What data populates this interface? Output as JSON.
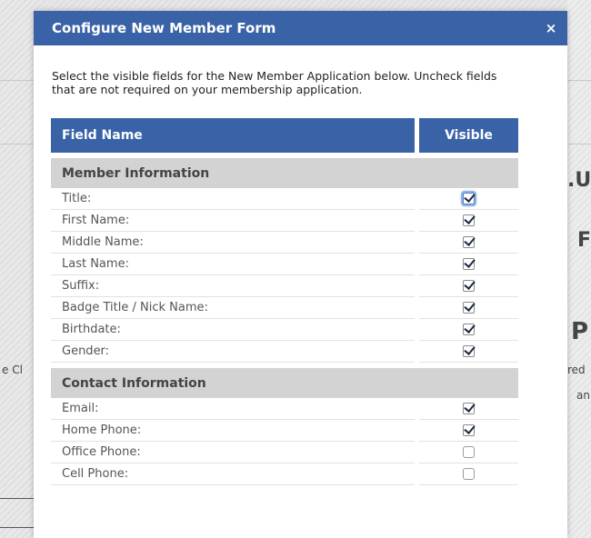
{
  "background": {
    "right_fragments": [
      ".U",
      "F",
      "P",
      "red",
      "an"
    ],
    "left_fragments": [
      "e Cl"
    ]
  },
  "modal": {
    "title": "Configure New Member Form",
    "close_icon": "close-icon",
    "close_glyph": "×",
    "intro": "Select the visible fields for the New Member Application below. Uncheck fields that are not required on your membership application.",
    "table": {
      "col_field": "Field Name",
      "col_visible": "Visible",
      "sections": [
        {
          "title": "Member Information",
          "fields": [
            {
              "label": "Title:",
              "visible": true,
              "focused": true
            },
            {
              "label": "First Name:",
              "visible": true
            },
            {
              "label": "Middle Name:",
              "visible": true
            },
            {
              "label": "Last Name:",
              "visible": true
            },
            {
              "label": "Suffix:",
              "visible": true
            },
            {
              "label": "Badge Title / Nick Name:",
              "visible": true
            },
            {
              "label": "Birthdate:",
              "visible": true
            },
            {
              "label": "Gender:",
              "visible": true
            }
          ]
        },
        {
          "title": "Contact Information",
          "fields": [
            {
              "label": "Email:",
              "visible": true
            },
            {
              "label": "Home Phone:",
              "visible": true
            },
            {
              "label": "Office Phone:",
              "visible": false
            },
            {
              "label": "Cell Phone:",
              "visible": false
            }
          ]
        }
      ]
    }
  }
}
